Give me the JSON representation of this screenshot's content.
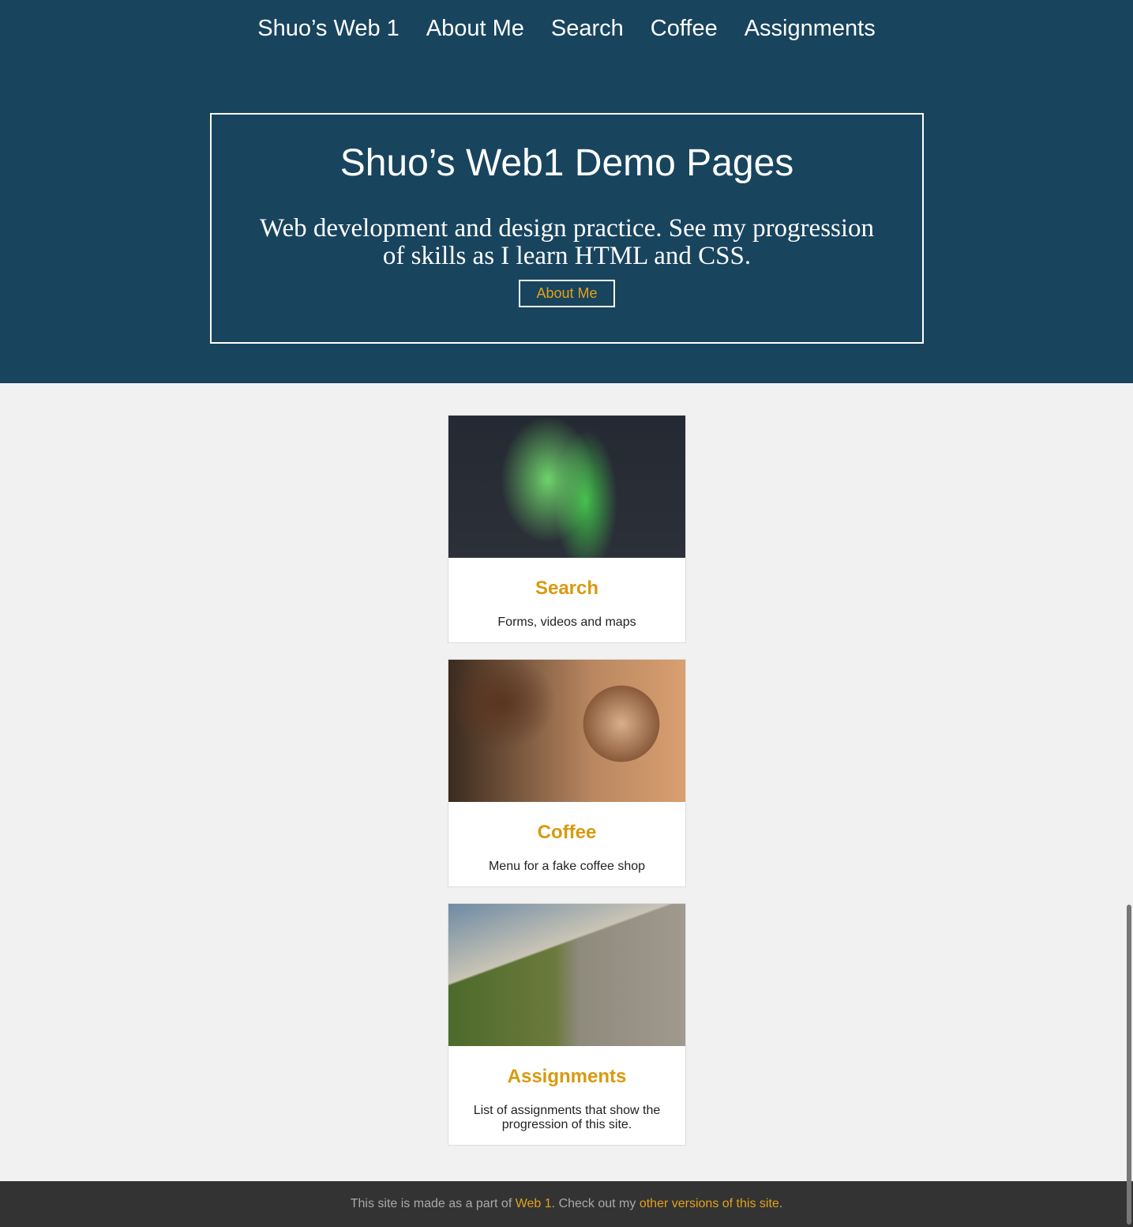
{
  "nav": [
    "Shuo’s Web 1",
    "About Me",
    "Search",
    "Coffee",
    "Assignments"
  ],
  "hero": {
    "title": "Shuo’s Web1 Demo Pages",
    "subtitle": "Web development and design practice. See my progression of skills as I learn HTML and CSS.",
    "button": "About Me"
  },
  "cards": [
    {
      "title": "Search",
      "desc": "Forms, videos and maps",
      "image": "aurora-image"
    },
    {
      "title": "Coffee",
      "desc": "Menu for a fake coffee shop",
      "image": "coffee-image"
    },
    {
      "title": "Assignments",
      "desc": "List of assignments that show the progression of this site.",
      "image": "coastline-image"
    }
  ],
  "footer": {
    "t1": "This site is made as a part of ",
    "l1": "Web 1",
    "t2": ". Check out my ",
    "l2": "other versions of this site",
    "t3": "."
  }
}
